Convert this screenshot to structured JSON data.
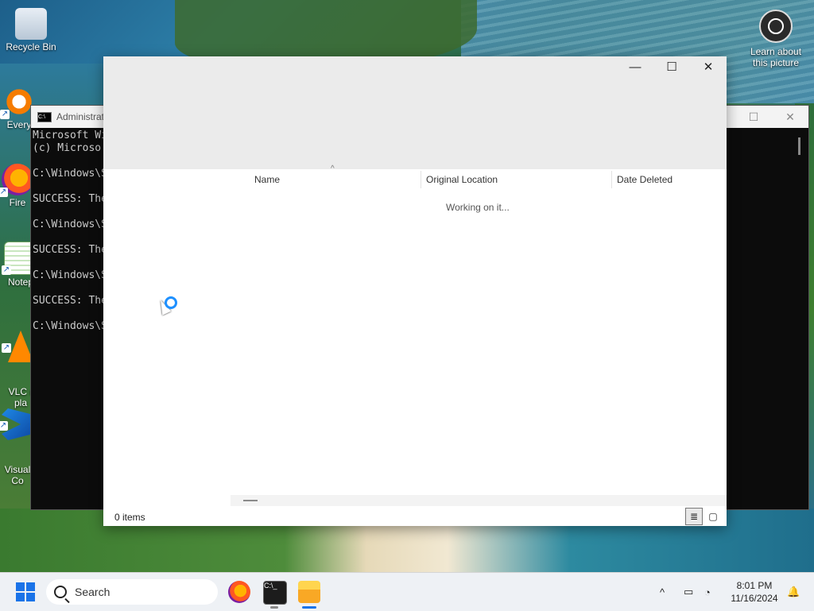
{
  "desktop": {
    "icons": [
      {
        "label": "Recycle Bin"
      },
      {
        "label": "Every"
      },
      {
        "label": "Fire"
      },
      {
        "label": "Notep"
      },
      {
        "label": "VLC r\npla"
      },
      {
        "label": "Visual\nCo"
      }
    ],
    "learn_label": "Learn about\nthis picture"
  },
  "cmd": {
    "title": "Administrat",
    "lines": [
      "Microsoft Wi",
      "(c) Microso",
      "",
      "C:\\Windows\\S",
      "",
      "SUCCESS: The",
      "",
      "C:\\Windows\\S",
      "",
      "SUCCESS: The",
      "",
      "C:\\Windows\\S",
      "",
      "SUCCESS: The",
      "",
      "C:\\Windows\\S"
    ]
  },
  "explorer": {
    "columns": {
      "name": "Name",
      "original_location": "Original Location",
      "date_deleted": "Date Deleted"
    },
    "working_text": "Working on it...",
    "status_items": "0 items"
  },
  "taskbar": {
    "search_placeholder": "Search",
    "time": "8:01 PM",
    "date": "11/16/2024"
  },
  "colors": {
    "accent": "#1a73e8",
    "cmd_bg": "#0c0c0c",
    "explorer_top": "#ebebeb"
  }
}
